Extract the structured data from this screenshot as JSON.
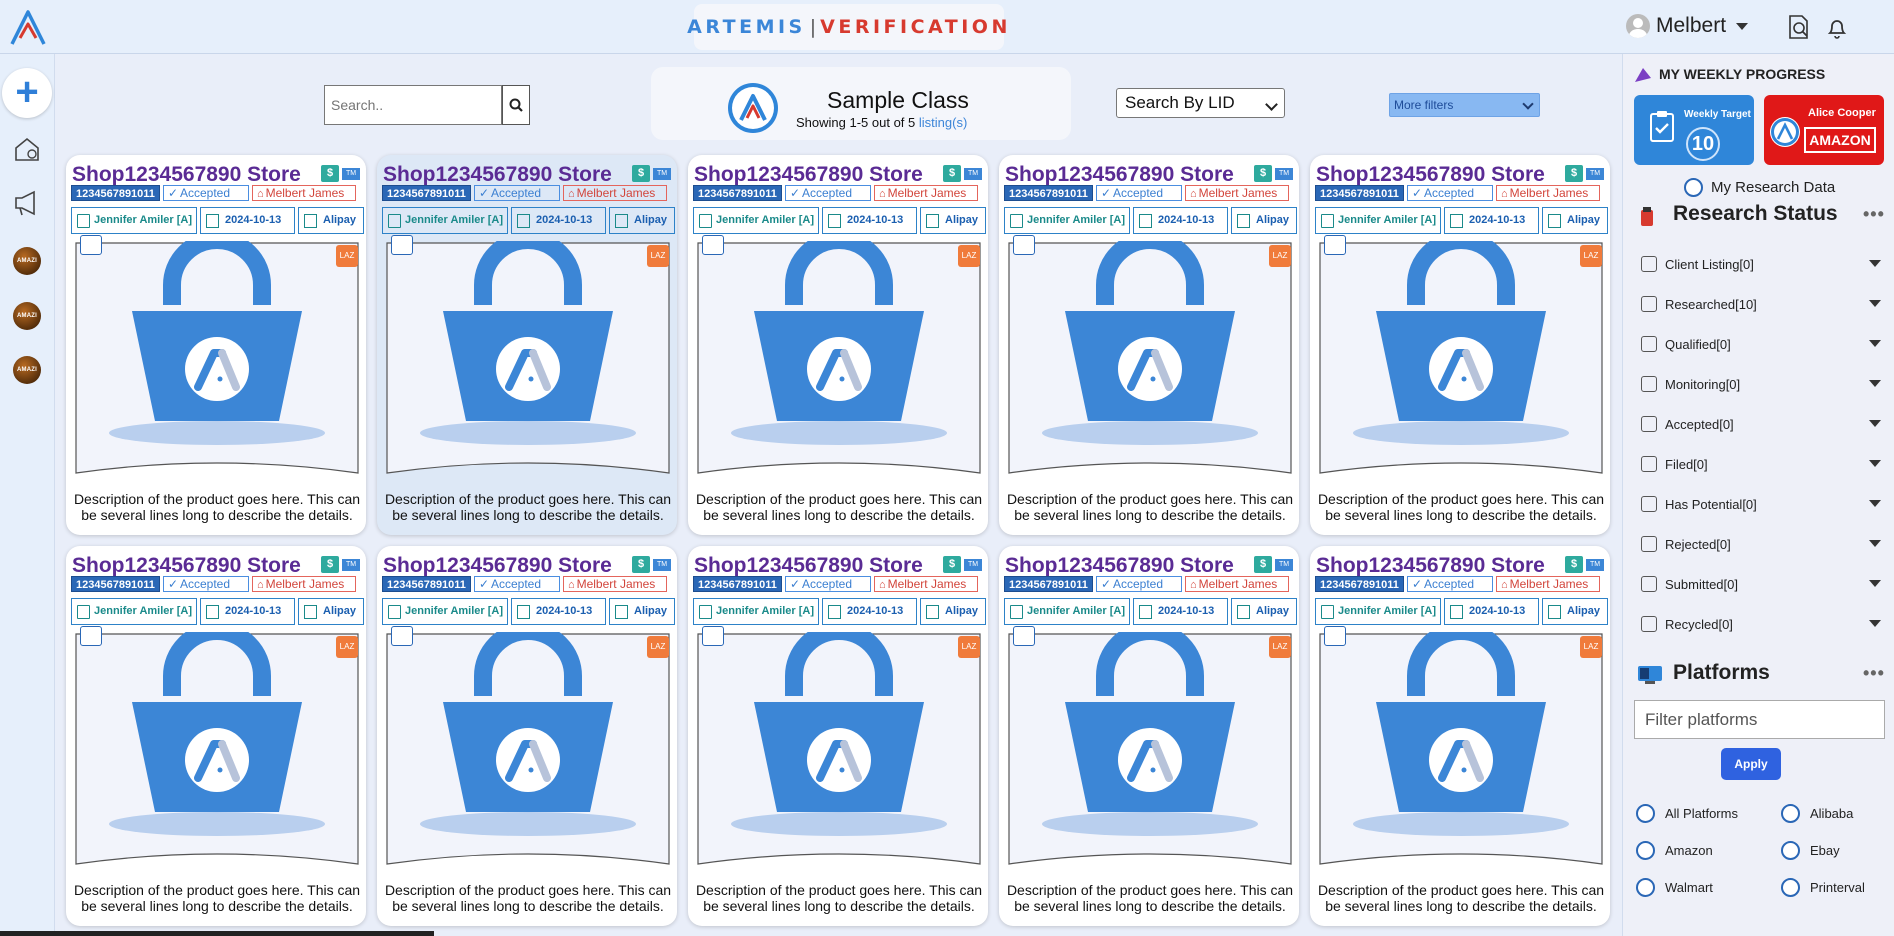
{
  "header": {
    "brand_left": "ARTEMIS",
    "brand_sep": "|",
    "brand_right": "VERIFICATION",
    "user_name": "Melbert",
    "icons": [
      "logo-icon",
      "search-doc-icon",
      "bell-icon"
    ]
  },
  "rail": {
    "plus_label": "+",
    "amazi_label": "AMAZI",
    "icons": [
      "home-icon",
      "megaphone-icon"
    ]
  },
  "toolbar": {
    "search_placeholder": "Search..",
    "class_title": "Sample Class",
    "class_sub": "Showing 1-5 out of 5",
    "class_sub_link": "listing(s)",
    "lid_select": "Search By LID",
    "more_filters": "More filters"
  },
  "cards": [
    {
      "title": "Shop1234567890 Store",
      "lid": "1234567891011",
      "status": "Accepted",
      "agent": "Melbert James",
      "researcher": "Jennifer Amiler [A]",
      "date": "2024-10-13",
      "platform": "Alipay",
      "desc": "Description of the product goes here. This can be several lines long to describe the details."
    },
    {
      "title": "Shop1234567890 Store",
      "lid": "1234567891011",
      "status": "Accepted",
      "agent": "Melbert James",
      "researcher": "Jennifer Amiler [A]",
      "date": "2024-10-13",
      "platform": "Alipay",
      "desc": "Description of the product goes here. This can be several lines long to describe the details."
    },
    {
      "title": "Shop1234567890 Store",
      "lid": "1234567891011",
      "status": "Accepted",
      "agent": "Melbert James",
      "researcher": "Jennifer Amiler [A]",
      "date": "2024-10-13",
      "platform": "Alipay",
      "desc": "Description of the product goes here. This can be several lines long to describe the details."
    },
    {
      "title": "Shop1234567890 Store",
      "lid": "1234567891011",
      "status": "Accepted",
      "agent": "Melbert James",
      "researcher": "Jennifer Amiler [A]",
      "date": "2024-10-13",
      "platform": "Alipay",
      "desc": "Description of the product goes here. This can be several lines long to describe the details."
    },
    {
      "title": "Shop1234567890 Store",
      "lid": "1234567891011",
      "status": "Accepted",
      "agent": "Melbert James",
      "researcher": "Jennifer Amiler [A]",
      "date": "2024-10-13",
      "platform": "Alipay",
      "desc": "Description of the product goes here. This can be several lines long to describe the details."
    },
    {
      "title": "Shop1234567890 Store",
      "lid": "1234567891011",
      "status": "Accepted",
      "agent": "Melbert James",
      "researcher": "Jennifer Amiler [A]",
      "date": "2024-10-13",
      "platform": "Alipay",
      "desc": "Description of the product goes here. This can be several lines long to describe the details."
    },
    {
      "title": "Shop1234567890 Store",
      "lid": "1234567891011",
      "status": "Accepted",
      "agent": "Melbert James",
      "researcher": "Jennifer Amiler [A]",
      "date": "2024-10-13",
      "platform": "Alipay",
      "desc": "Description of the product goes here. This can be several lines long to describe the details."
    },
    {
      "title": "Shop1234567890 Store",
      "lid": "1234567891011",
      "status": "Accepted",
      "agent": "Melbert James",
      "researcher": "Jennifer Amiler [A]",
      "date": "2024-10-13",
      "platform": "Alipay",
      "desc": "Description of the product goes here. This can be several lines long to describe the details."
    },
    {
      "title": "Shop1234567890 Store",
      "lid": "1234567891011",
      "status": "Accepted",
      "agent": "Melbert James",
      "researcher": "Jennifer Amiler [A]",
      "date": "2024-10-13",
      "platform": "Alipay",
      "desc": "Description of the product goes here. This can be several lines long to describe the details."
    },
    {
      "title": "Shop1234567890 Store",
      "lid": "1234567891011",
      "status": "Accepted",
      "agent": "Melbert James",
      "researcher": "Jennifer Amiler [A]",
      "date": "2024-10-13",
      "platform": "Alipay",
      "desc": "Description of the product goes here. This can be several lines long to describe the details."
    }
  ],
  "card_badges": {
    "dollar": "$",
    "tm": "TM",
    "corner": "LAZ"
  },
  "right_panel": {
    "weekly_title": "MY WEEKLY PROGRESS",
    "weekly_target_label": "Weekly Target",
    "weekly_target_value": "10",
    "alice_label": "Alice Cooper",
    "alice_platform": "AMAZON",
    "my_research_data": "My Research Data",
    "research_status_title": "Research Status",
    "statuses": [
      "Client Listing[0]",
      "Researched[10]",
      "Qualified[0]",
      "Monitoring[0]",
      "Accepted[0]",
      "Filed[0]",
      "Has Potential[0]",
      "Rejected[0]",
      "Submitted[0]",
      "Recycled[0]"
    ],
    "platforms_title": "Platforms",
    "platform_filter_placeholder": "Filter platforms",
    "apply_label": "Apply",
    "platforms": [
      "All Platforms",
      "Alibaba",
      "Amazon",
      "Ebay",
      "Walmart",
      "Printerval"
    ],
    "more_dots": "•••"
  },
  "colors": {
    "accent_blue": "#2f86d9",
    "title_purple": "#5a2b94",
    "agent_red": "#d2453b",
    "alice_red": "#e01818",
    "apply_blue": "#2f62e0"
  }
}
